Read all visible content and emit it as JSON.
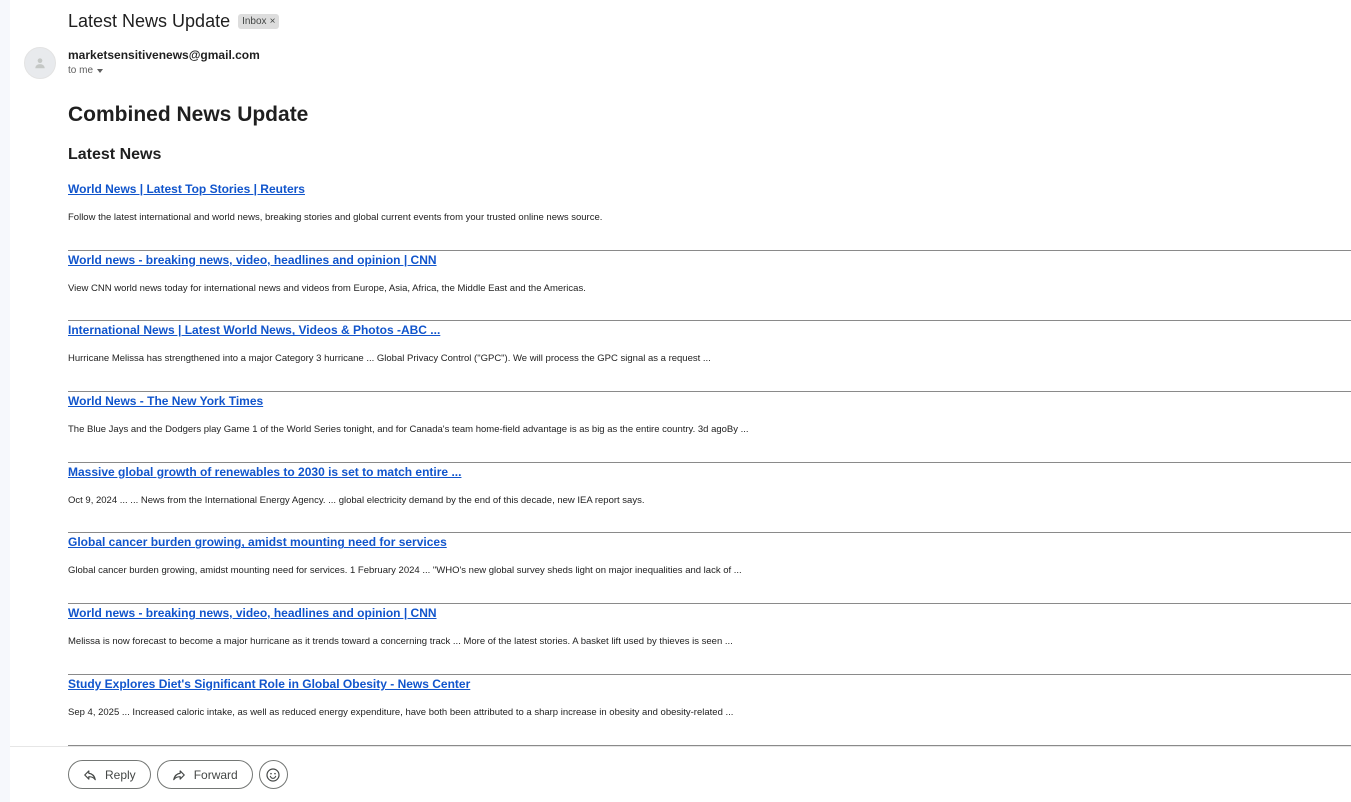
{
  "email": {
    "subject": "Latest News Update",
    "label": "Inbox",
    "label_remove": "×",
    "sender": "marketsensitivenews@gmail.com",
    "recipient": "to me"
  },
  "content": {
    "heading": "Combined News Update",
    "subheading": "Latest News",
    "items": [
      {
        "title": "World News | Latest Top Stories | Reuters",
        "snippet": "Follow the latest international and world news, breaking stories and global current events from your trusted online news source."
      },
      {
        "title": "World news - breaking news, video, headlines and opinion | CNN",
        "snippet": "View CNN world news today for international news and videos from Europe, Asia, Africa, the Middle East and the Americas."
      },
      {
        "title": "International News | Latest World News, Videos & Photos -ABC ...",
        "snippet": "Hurricane Melissa has strengthened into a major Category 3 hurricane ... Global Privacy Control (\"GPC\"). We will process the GPC signal as a request ..."
      },
      {
        "title": "World News - The New York Times",
        "snippet": "The Blue Jays and the Dodgers play Game 1 of the World Series tonight, and for Canada's team home-field advantage is as big as the entire country. 3d agoBy ..."
      },
      {
        "title": "Massive global growth of renewables to 2030 is set to match entire ...",
        "snippet": "Oct 9, 2024 ... ... News from the International Energy Agency. ... global electricity demand by the end of this decade, new IEA report says."
      },
      {
        "title": "Global cancer burden growing, amidst mounting need for services",
        "snippet": "Global cancer burden growing, amidst mounting need for services. 1 February 2024 ... \"WHO's new global survey sheds light on major inequalities and lack of ..."
      },
      {
        "title": "World news - breaking news, video, headlines and opinion | CNN",
        "snippet": "Melissa is now forecast to become a major hurricane as it trends toward a concerning track ... More of the latest stories. A basket lift used by thieves is seen ..."
      },
      {
        "title": "Study Explores Diet's Significant Role in Global Obesity - News Center",
        "snippet": "Sep 4, 2025 ... Increased caloric intake, as well as reduced energy expenditure, have both been attributed to a sharp increase in obesity and obesity-related ..."
      }
    ]
  },
  "actions": {
    "reply": "Reply",
    "forward": "Forward"
  },
  "icons": {
    "avatar": "person-icon",
    "reply": "reply-icon",
    "forward": "forward-icon",
    "emoji": "emoji-icon"
  },
  "colors": {
    "link": "#1155cc",
    "divider": "#8a8a8a"
  }
}
